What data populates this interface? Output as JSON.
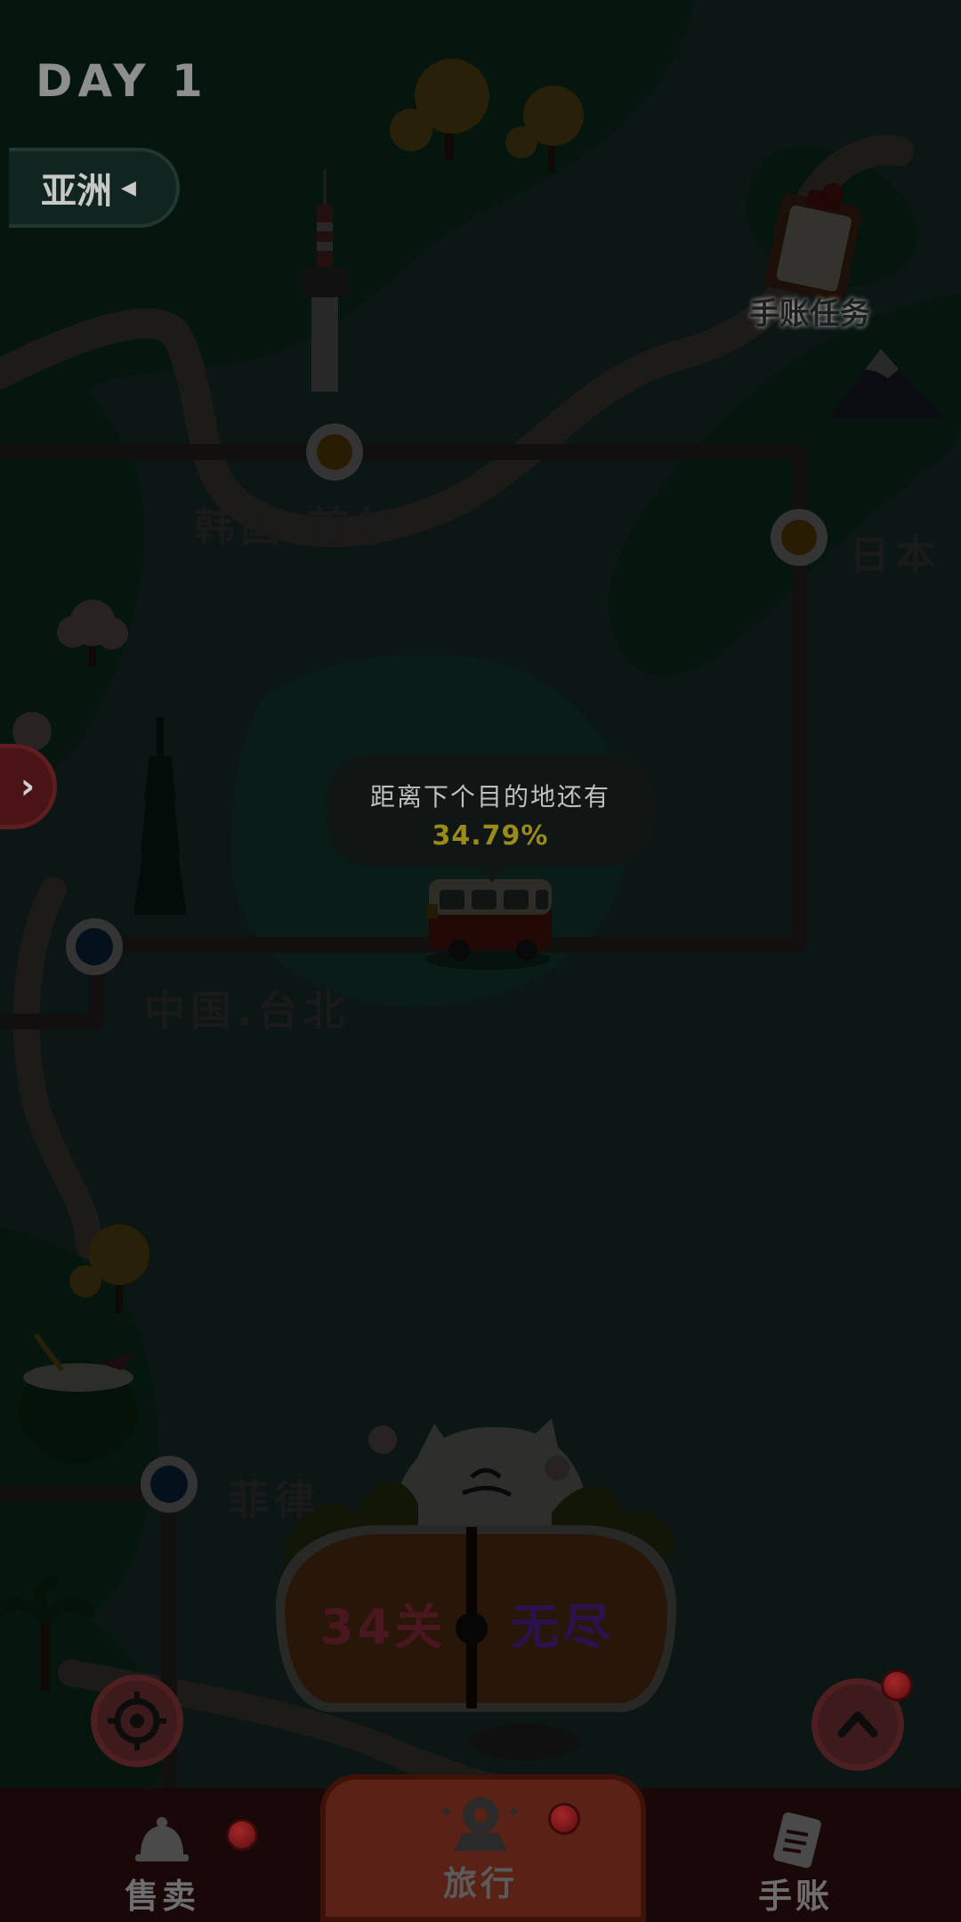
{
  "day_label": "DAY 1",
  "region_tab": {
    "label": "亚洲"
  },
  "cities": {
    "seoul": "韩国.首尔",
    "japan": "日本",
    "taipei": "中国.台北",
    "philippines": "菲律"
  },
  "task": {
    "label": "手账任务"
  },
  "progress_bubble": {
    "text": "距离下个目的地还有",
    "percent": "34.79%"
  },
  "play_button": {
    "level_label": "34关",
    "endless_label": "无尽"
  },
  "bottom_nav": {
    "items": [
      {
        "label": "售卖",
        "has_badge": true
      },
      {
        "label": "旅行",
        "has_badge": true,
        "active": true
      },
      {
        "label": "手账",
        "has_badge": false
      }
    ]
  },
  "colors": {
    "dim_overlay": "#000000",
    "water": "#1f3b37",
    "land": "#0d3a23",
    "road": "#3f3b35",
    "percent": "#9b8a1a",
    "level_text": "#6b1620",
    "endless_text": "#2e1260"
  },
  "icons": [
    "tower-landmark-icon",
    "taipei-101-icon",
    "mountain-fuji-icon",
    "clipboard-icon",
    "bus-icon",
    "target-icon",
    "chevron-up-icon",
    "chevron-right-icon",
    "bell-icon",
    "map-pin-icon",
    "notebook-icon"
  ]
}
